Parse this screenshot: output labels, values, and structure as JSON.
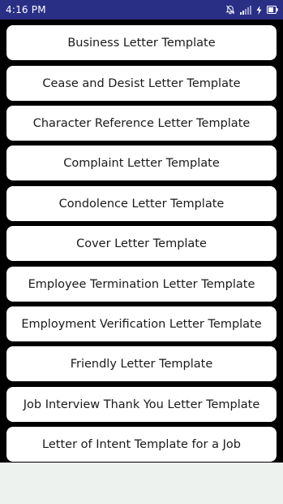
{
  "status_bar": {
    "time": "4:16 PM",
    "icons": [
      "mute-icon",
      "signal-icon",
      "charging-bolt-icon",
      "battery-icon"
    ],
    "background_color": "#2a2f86"
  },
  "templates": {
    "items": [
      {
        "label": "Business Letter Template"
      },
      {
        "label": "Cease and Desist Letter Template"
      },
      {
        "label": "Character Reference Letter Template"
      },
      {
        "label": "Complaint Letter Template"
      },
      {
        "label": "Condolence Letter Template"
      },
      {
        "label": "Cover Letter Template"
      },
      {
        "label": "Employee Termination Letter Template"
      },
      {
        "label": "Employment Verification Letter Template"
      },
      {
        "label": "Friendly Letter Template"
      },
      {
        "label": "Job Interview Thank You Letter Template"
      },
      {
        "label": "Letter of Intent Template for a Job"
      }
    ]
  },
  "colors": {
    "list_background": "#000000",
    "item_background": "#ffffff",
    "page_background": "#eef2ef"
  }
}
